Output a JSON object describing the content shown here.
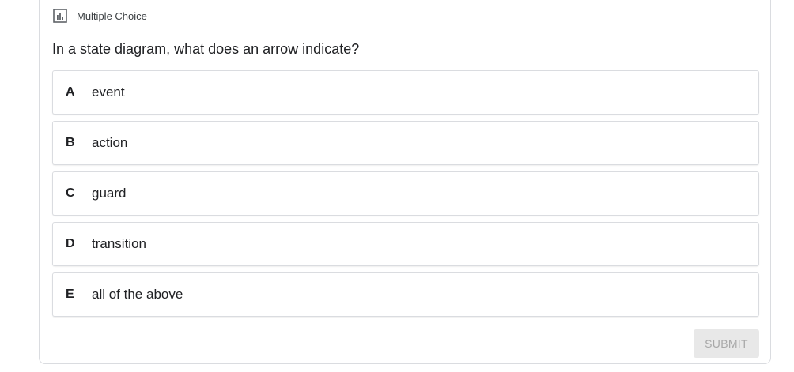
{
  "question_type": {
    "icon": "poll-chart-icon",
    "label": "Multiple Choice"
  },
  "question": "In a state diagram, what does an arrow indicate?",
  "options": [
    {
      "letter": "A",
      "text": "event"
    },
    {
      "letter": "B",
      "text": "action"
    },
    {
      "letter": "C",
      "text": "guard"
    },
    {
      "letter": "D",
      "text": "transition"
    },
    {
      "letter": "E",
      "text": "all of the above"
    }
  ],
  "submit_label": "SUBMIT",
  "colors": {
    "border": "#dadce0",
    "text": "#202124",
    "submit_bg": "#e8e8e8",
    "submit_text": "#a8a8a8"
  }
}
